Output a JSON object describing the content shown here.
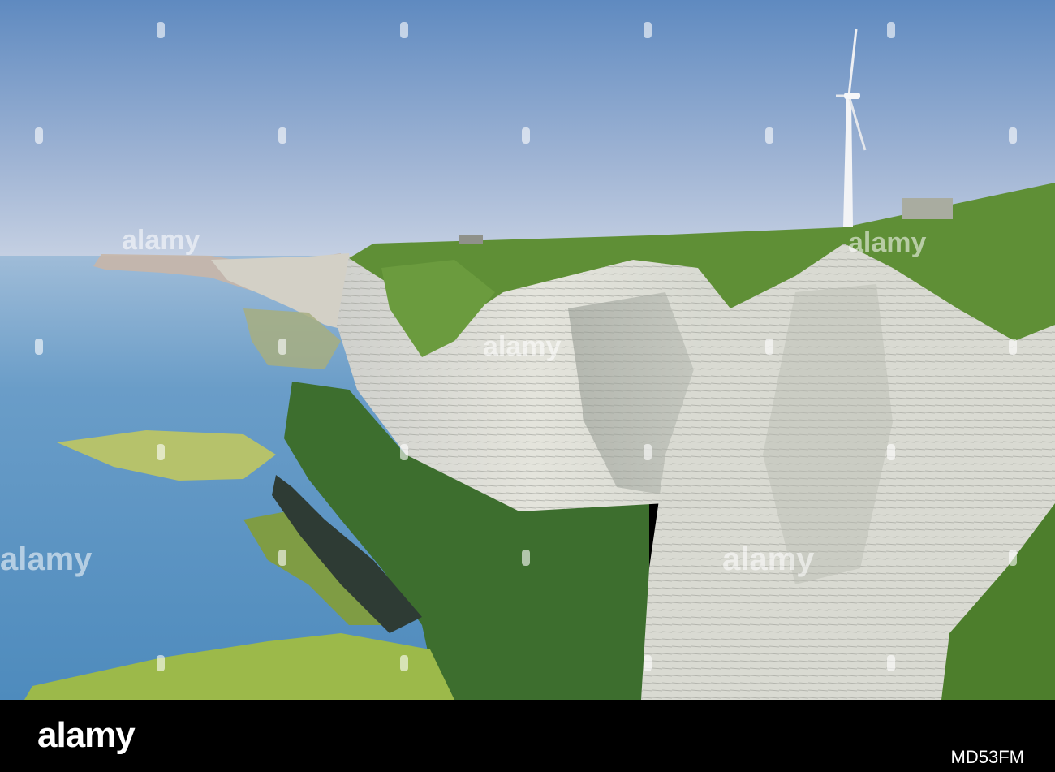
{
  "footer": {
    "brand": "alamy",
    "image_code": "MD53FM"
  },
  "watermark": {
    "text": "alamy"
  },
  "colors": {
    "sky_top": "#5f8cc0",
    "sky_bottom": "#c9d4e6",
    "sea": "#5d95c2",
    "cliff_white": "#dcdcd4",
    "grass": "#5a8a35",
    "footer_bg": "#000000"
  }
}
